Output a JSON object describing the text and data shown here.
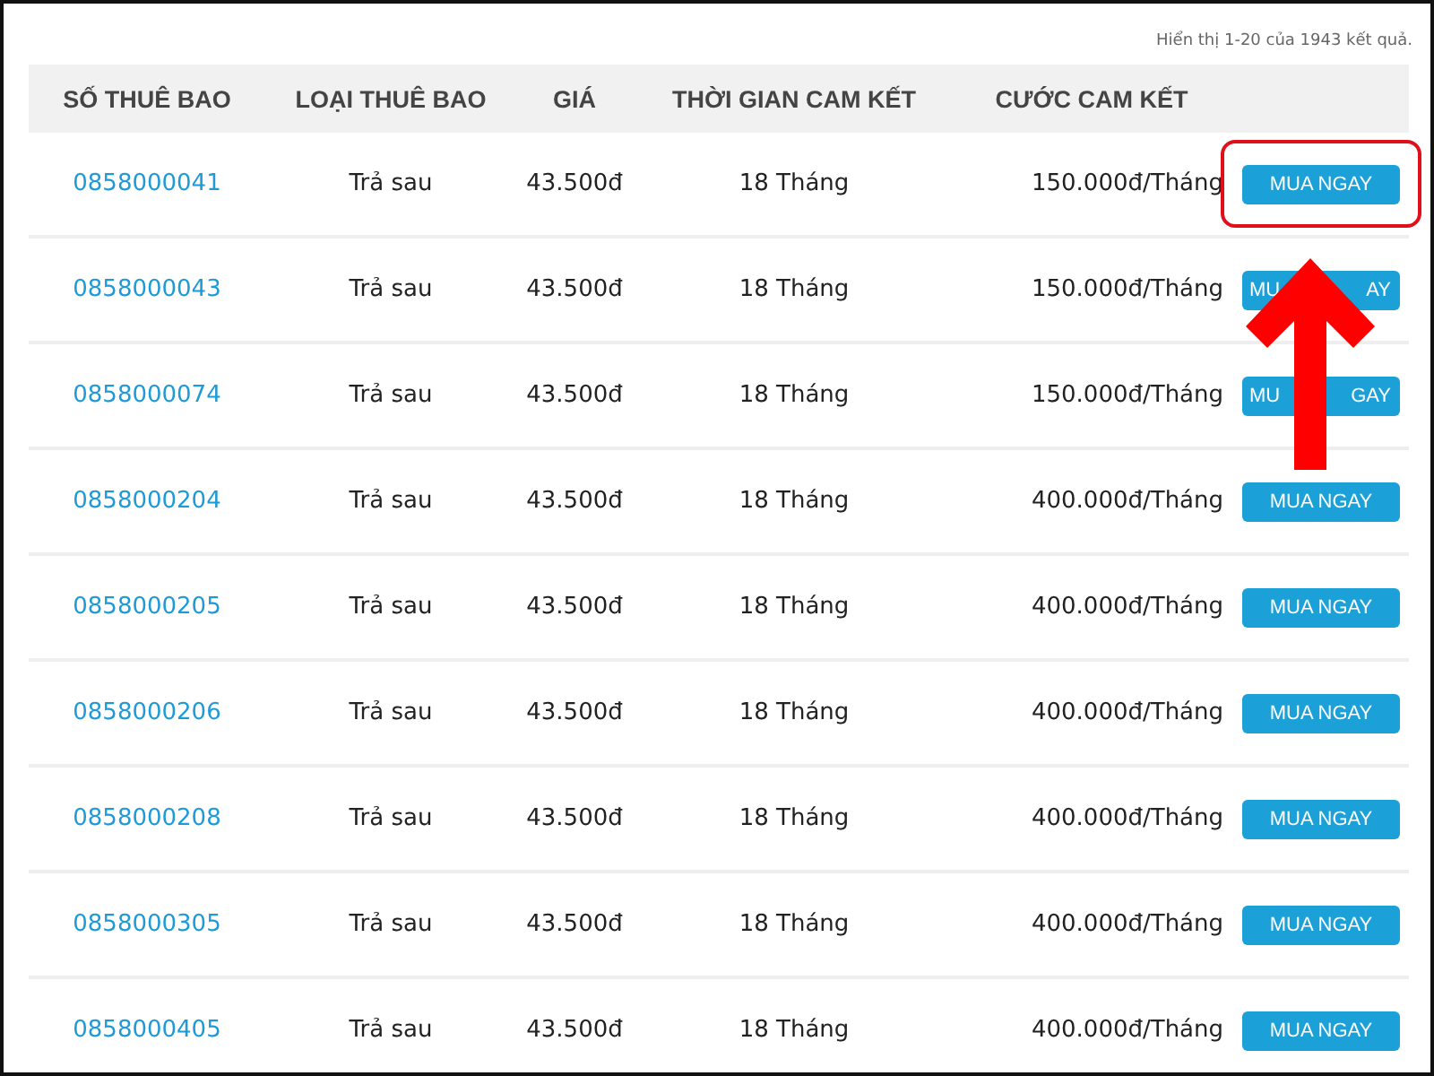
{
  "summary": "Hiển thị 1-20 của 1943 kết quả.",
  "table": {
    "columns": [
      "SỐ THUÊ BAO",
      "LOẠI THUÊ BAO",
      "GIÁ",
      "THỜI GIAN CAM KẾT",
      "CƯỚC CAM KẾT"
    ],
    "rows": [
      {
        "number": "0858000041",
        "type": "Trả sau",
        "price": "43.500đ",
        "term": "18 Tháng",
        "fee": "150.000đ/Tháng",
        "button": "MUA NGAY",
        "highlighted": true
      },
      {
        "number": "0858000043",
        "type": "Trả sau",
        "price": "43.500đ",
        "term": "18 Tháng",
        "fee": "150.000đ/Tháng",
        "button": [
          "MU",
          "AY"
        ],
        "highlighted": false
      },
      {
        "number": "0858000074",
        "type": "Trả sau",
        "price": "43.500đ",
        "term": "18 Tháng",
        "fee": "150.000đ/Tháng",
        "button": [
          "MU",
          "GAY"
        ],
        "highlighted": false
      },
      {
        "number": "0858000204",
        "type": "Trả sau",
        "price": "43.500đ",
        "term": "18 Tháng",
        "fee": "400.000đ/Tháng",
        "button": "MUA NGAY",
        "highlighted": false
      },
      {
        "number": "0858000205",
        "type": "Trả sau",
        "price": "43.500đ",
        "term": "18 Tháng",
        "fee": "400.000đ/Tháng",
        "button": "MUA NGAY",
        "highlighted": false
      },
      {
        "number": "0858000206",
        "type": "Trả sau",
        "price": "43.500đ",
        "term": "18 Tháng",
        "fee": "400.000đ/Tháng",
        "button": "MUA NGAY",
        "highlighted": false
      },
      {
        "number": "0858000208",
        "type": "Trả sau",
        "price": "43.500đ",
        "term": "18 Tháng",
        "fee": "400.000đ/Tháng",
        "button": "MUA NGAY",
        "highlighted": false
      },
      {
        "number": "0858000305",
        "type": "Trả sau",
        "price": "43.500đ",
        "term": "18 Tháng",
        "fee": "400.000đ/Tháng",
        "button": "MUA NGAY",
        "highlighted": false
      },
      {
        "number": "0858000405",
        "type": "Trả sau",
        "price": "43.500đ",
        "term": "18 Tháng",
        "fee": "400.000đ/Tháng",
        "button": "MUA NGAY",
        "highlighted": false
      }
    ]
  }
}
